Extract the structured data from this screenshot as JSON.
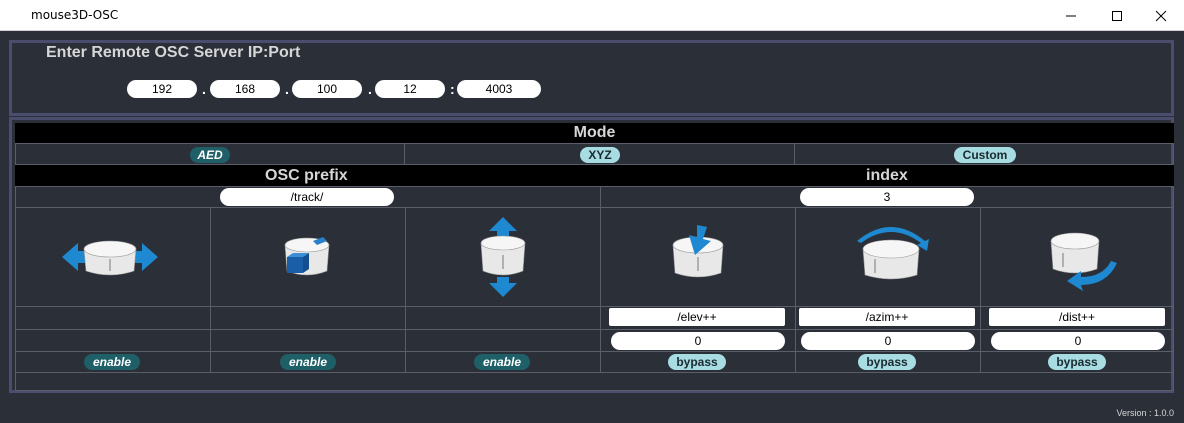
{
  "window": {
    "title": "mouse3D-OSC",
    "controls": [
      "minimize-icon",
      "maximize-icon",
      "close-icon"
    ]
  },
  "ip": {
    "heading": "Enter Remote OSC Server IP:Port",
    "octets": [
      "192",
      "168",
      "100",
      "12"
    ],
    "dot": ".",
    "colon": ":",
    "port": "4003"
  },
  "mode": {
    "label": "Mode",
    "options": [
      {
        "label": "AED",
        "selected": true
      },
      {
        "label": "XYZ",
        "selected": false
      },
      {
        "label": "Custom",
        "selected": false
      }
    ]
  },
  "prefix": {
    "label": "OSC prefix",
    "value": "/track/"
  },
  "index": {
    "label": "index",
    "value": "3"
  },
  "axes": [
    {
      "icon": "pan-x-icon",
      "address": "",
      "value": "",
      "toggle": "enable"
    },
    {
      "icon": "pan-y-icon",
      "address": "",
      "value": "",
      "toggle": "enable"
    },
    {
      "icon": "pan-z-icon",
      "address": "",
      "value": "",
      "toggle": "enable"
    },
    {
      "icon": "tilt-icon",
      "address": "/elev++",
      "value": "0",
      "toggle": "bypass"
    },
    {
      "icon": "rotate-icon",
      "address": "/azim++",
      "value": "0",
      "toggle": "bypass"
    },
    {
      "icon": "roll-icon",
      "address": "/dist++",
      "value": "0",
      "toggle": "bypass"
    }
  ],
  "colors": {
    "background": "#2b2f38",
    "panel_border": "#4a4d6d",
    "pill_dark": "#1f5f68",
    "pill_light": "#a7dce3",
    "arrow_blue": "#1e88d0"
  },
  "version": "Version : 1.0.0"
}
